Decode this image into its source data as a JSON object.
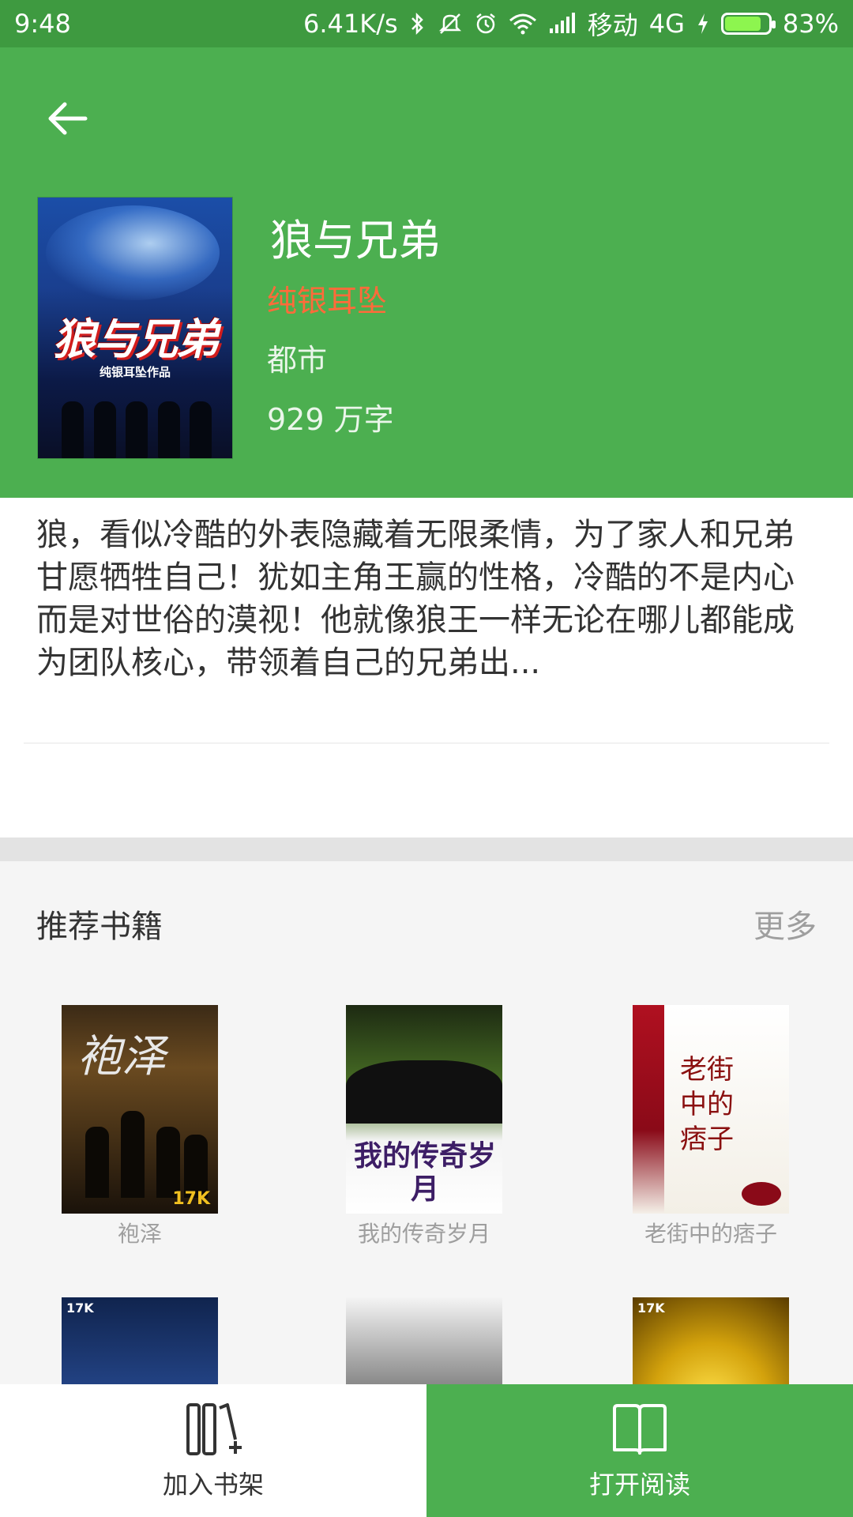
{
  "status": {
    "time": "9:48",
    "speed": "6.41K/s",
    "carrier": "移动",
    "network": "4G",
    "battery": "83%",
    "battery_level": 0.83
  },
  "book": {
    "title": "狼与兄弟",
    "author": "纯银耳坠",
    "category": "都市",
    "words": "929 万字",
    "cover_title": "狼与兄弟",
    "cover_subtitle": "纯银耳坠作品",
    "description": "狼，看似冷酷的外表隐藏着无限柔情，为了家人和兄弟甘愿牺牲自己！犹如主角王赢的性格，冷酷的不是内心而是对世俗的漠视！他就像狼王一样无论在哪儿都能成为团队核心，带领着自己的兄弟出..."
  },
  "recommend": {
    "title": "推荐书籍",
    "more": "更多",
    "books": [
      {
        "label": "袍泽",
        "cover_text": "袍泽",
        "logo": "17K"
      },
      {
        "label": "我的传奇岁月",
        "cover_text": "我的传奇岁月"
      },
      {
        "label": "老街中的痞子",
        "cover_text": "老街中的痞子"
      },
      {
        "label": "",
        "logo": "17K"
      },
      {
        "label": ""
      },
      {
        "label": "",
        "logo": "17K"
      }
    ]
  },
  "bottom": {
    "add_shelf": "加入书架",
    "open_read": "打开阅读"
  },
  "colors": {
    "primary": "#4caf50",
    "status_bar": "#3e9a40",
    "author": "#ff6b3a"
  }
}
